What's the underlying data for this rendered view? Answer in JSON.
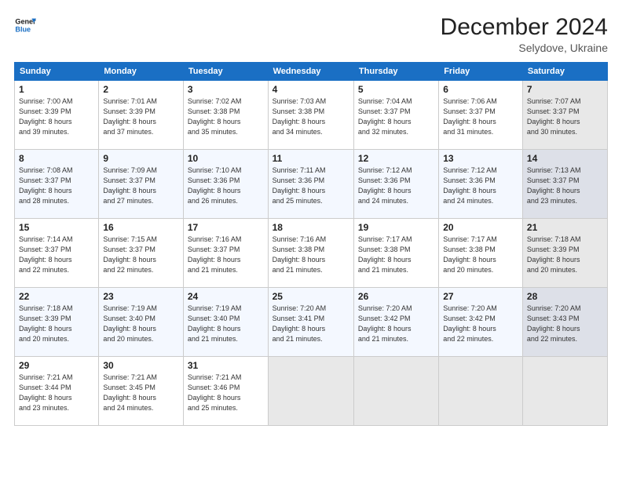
{
  "header": {
    "logo_line1": "General",
    "logo_line2": "Blue",
    "main_title": "December 2024",
    "subtitle": "Selydove, Ukraine"
  },
  "calendar": {
    "weekdays": [
      "Sunday",
      "Monday",
      "Tuesday",
      "Wednesday",
      "Thursday",
      "Friday",
      "Saturday"
    ],
    "weeks": [
      [
        {
          "day": "1",
          "info": "Sunrise: 7:00 AM\nSunset: 3:39 PM\nDaylight: 8 hours\nand 39 minutes."
        },
        {
          "day": "2",
          "info": "Sunrise: 7:01 AM\nSunset: 3:39 PM\nDaylight: 8 hours\nand 37 minutes."
        },
        {
          "day": "3",
          "info": "Sunrise: 7:02 AM\nSunset: 3:38 PM\nDaylight: 8 hours\nand 35 minutes."
        },
        {
          "day": "4",
          "info": "Sunrise: 7:03 AM\nSunset: 3:38 PM\nDaylight: 8 hours\nand 34 minutes."
        },
        {
          "day": "5",
          "info": "Sunrise: 7:04 AM\nSunset: 3:37 PM\nDaylight: 8 hours\nand 32 minutes."
        },
        {
          "day": "6",
          "info": "Sunrise: 7:06 AM\nSunset: 3:37 PM\nDaylight: 8 hours\nand 31 minutes."
        },
        {
          "day": "7",
          "info": "Sunrise: 7:07 AM\nSunset: 3:37 PM\nDaylight: 8 hours\nand 30 minutes."
        }
      ],
      [
        {
          "day": "8",
          "info": "Sunrise: 7:08 AM\nSunset: 3:37 PM\nDaylight: 8 hours\nand 28 minutes."
        },
        {
          "day": "9",
          "info": "Sunrise: 7:09 AM\nSunset: 3:37 PM\nDaylight: 8 hours\nand 27 minutes."
        },
        {
          "day": "10",
          "info": "Sunrise: 7:10 AM\nSunset: 3:36 PM\nDaylight: 8 hours\nand 26 minutes."
        },
        {
          "day": "11",
          "info": "Sunrise: 7:11 AM\nSunset: 3:36 PM\nDaylight: 8 hours\nand 25 minutes."
        },
        {
          "day": "12",
          "info": "Sunrise: 7:12 AM\nSunset: 3:36 PM\nDaylight: 8 hours\nand 24 minutes."
        },
        {
          "day": "13",
          "info": "Sunrise: 7:12 AM\nSunset: 3:36 PM\nDaylight: 8 hours\nand 24 minutes."
        },
        {
          "day": "14",
          "info": "Sunrise: 7:13 AM\nSunset: 3:37 PM\nDaylight: 8 hours\nand 23 minutes."
        }
      ],
      [
        {
          "day": "15",
          "info": "Sunrise: 7:14 AM\nSunset: 3:37 PM\nDaylight: 8 hours\nand 22 minutes."
        },
        {
          "day": "16",
          "info": "Sunrise: 7:15 AM\nSunset: 3:37 PM\nDaylight: 8 hours\nand 22 minutes."
        },
        {
          "day": "17",
          "info": "Sunrise: 7:16 AM\nSunset: 3:37 PM\nDaylight: 8 hours\nand 21 minutes."
        },
        {
          "day": "18",
          "info": "Sunrise: 7:16 AM\nSunset: 3:38 PM\nDaylight: 8 hours\nand 21 minutes."
        },
        {
          "day": "19",
          "info": "Sunrise: 7:17 AM\nSunset: 3:38 PM\nDaylight: 8 hours\nand 21 minutes."
        },
        {
          "day": "20",
          "info": "Sunrise: 7:17 AM\nSunset: 3:38 PM\nDaylight: 8 hours\nand 20 minutes."
        },
        {
          "day": "21",
          "info": "Sunrise: 7:18 AM\nSunset: 3:39 PM\nDaylight: 8 hours\nand 20 minutes."
        }
      ],
      [
        {
          "day": "22",
          "info": "Sunrise: 7:18 AM\nSunset: 3:39 PM\nDaylight: 8 hours\nand 20 minutes."
        },
        {
          "day": "23",
          "info": "Sunrise: 7:19 AM\nSunset: 3:40 PM\nDaylight: 8 hours\nand 20 minutes."
        },
        {
          "day": "24",
          "info": "Sunrise: 7:19 AM\nSunset: 3:40 PM\nDaylight: 8 hours\nand 21 minutes."
        },
        {
          "day": "25",
          "info": "Sunrise: 7:20 AM\nSunset: 3:41 PM\nDaylight: 8 hours\nand 21 minutes."
        },
        {
          "day": "26",
          "info": "Sunrise: 7:20 AM\nSunset: 3:42 PM\nDaylight: 8 hours\nand 21 minutes."
        },
        {
          "day": "27",
          "info": "Sunrise: 7:20 AM\nSunset: 3:42 PM\nDaylight: 8 hours\nand 22 minutes."
        },
        {
          "day": "28",
          "info": "Sunrise: 7:20 AM\nSunset: 3:43 PM\nDaylight: 8 hours\nand 22 minutes."
        }
      ],
      [
        {
          "day": "29",
          "info": "Sunrise: 7:21 AM\nSunset: 3:44 PM\nDaylight: 8 hours\nand 23 minutes."
        },
        {
          "day": "30",
          "info": "Sunrise: 7:21 AM\nSunset: 3:45 PM\nDaylight: 8 hours\nand 24 minutes."
        },
        {
          "day": "31",
          "info": "Sunrise: 7:21 AM\nSunset: 3:46 PM\nDaylight: 8 hours\nand 25 minutes."
        },
        {
          "day": "",
          "info": ""
        },
        {
          "day": "",
          "info": ""
        },
        {
          "day": "",
          "info": ""
        },
        {
          "day": "",
          "info": ""
        }
      ]
    ]
  }
}
